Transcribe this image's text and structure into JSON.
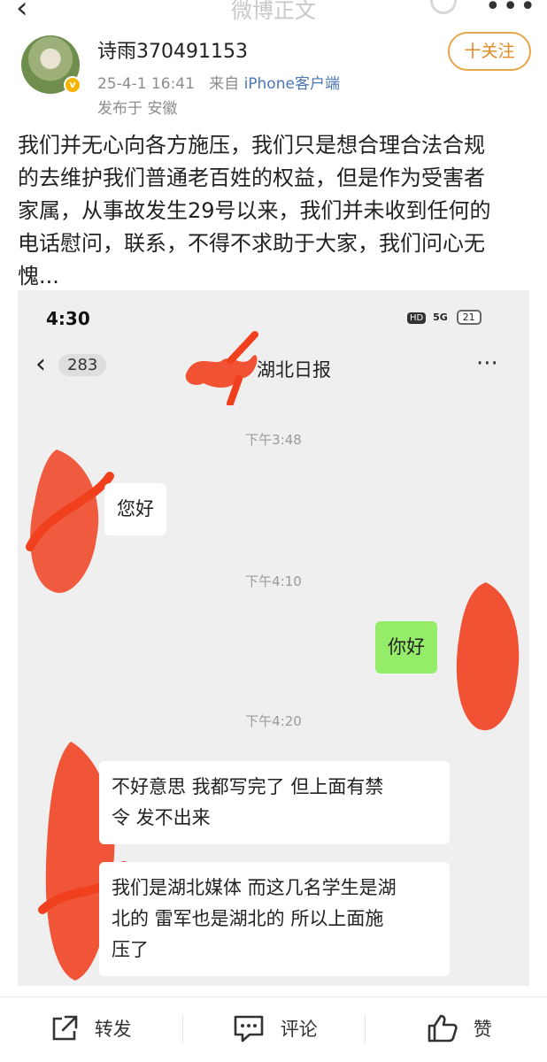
{
  "header": {
    "back_icon": "chevron-left-icon",
    "title": "微博正文",
    "search_icon": "search-icon",
    "more_icon": "more-icon"
  },
  "author": {
    "name": "诗雨370491153",
    "timestamp": "25-4-1 16:41",
    "from_prefix": "来自",
    "source": "iPhone客户端",
    "location": "发布于 安徽",
    "follow_label": "十关注",
    "verified_color": "#f6b300"
  },
  "post": {
    "lines": [
      "我们并无心向各方施压，我们只是想合理合法合规",
      "的去维护我们普通老百姓的权益，但是作为受害者",
      "家属，从事故发生29号以来，我们并未收到任何的",
      "电话慰问，联系，不得不求助于大家，我们问心无",
      "愧..."
    ]
  },
  "screenshot": {
    "status_time": "4:30",
    "status_hd": "HD",
    "status_signal": "5G",
    "status_battery": "21",
    "back_count": "283",
    "chat_title": "湖北日报",
    "chat_more": "···",
    "messages": [
      {
        "time": "下午3:48"
      },
      {
        "text": "您好",
        "side": "left"
      },
      {
        "time": "下午4:10"
      },
      {
        "text": "你好",
        "side": "right"
      },
      {
        "time": "下午4:20"
      },
      {
        "text_lines": [
          "不好意思 我都写完了 但上面有禁",
          "令 发不出来"
        ],
        "side": "left"
      },
      {
        "text_lines": [
          "我们是湖北媒体 而这几名学生是湖",
          "北的 雷军也是湖北的 所以上面施",
          "压了"
        ],
        "side": "left"
      }
    ],
    "redaction_color": "#f0401e",
    "my_bubble_color": "#95ec69"
  },
  "bottom": {
    "repost_label": "转发",
    "comment_label": "评论",
    "like_label": "赞",
    "repost_icon": "share-icon",
    "comment_icon": "comment-icon",
    "like_icon": "thumbs-up-icon"
  }
}
